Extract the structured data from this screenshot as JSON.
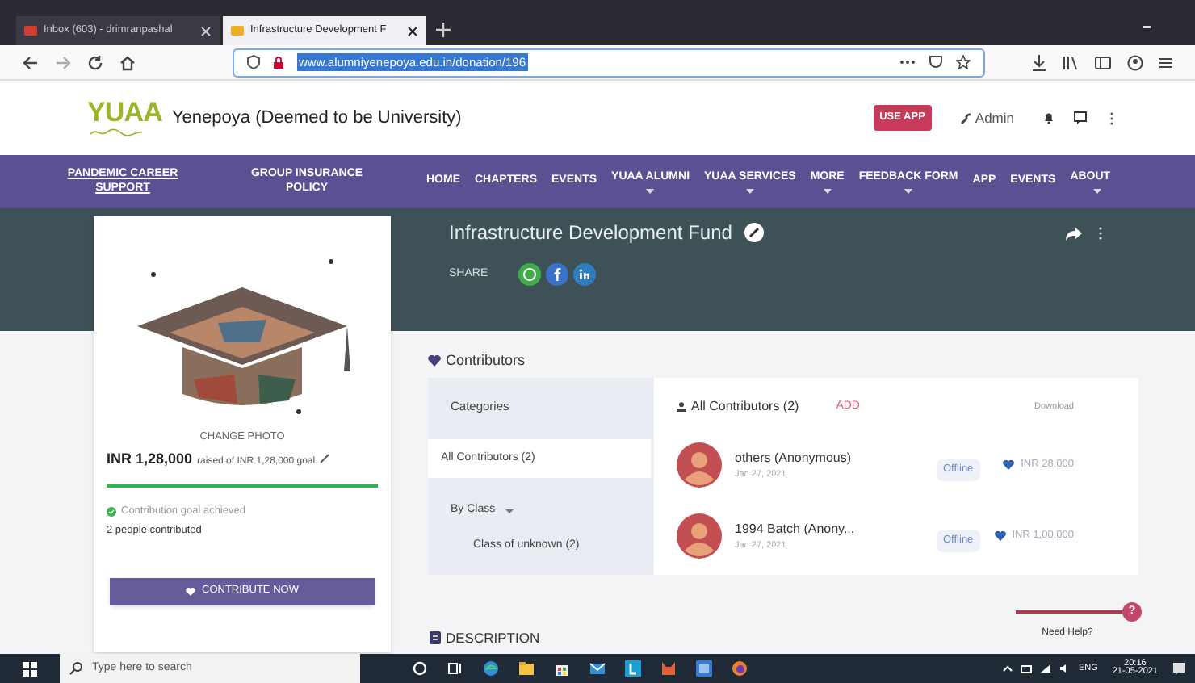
{
  "browser": {
    "tabs": [
      {
        "title": "Inbox (603) - drimranpashal",
        "selected": false
      },
      {
        "title": "Infrastructure Development F",
        "selected": true
      }
    ],
    "url": "www.alumniyenepoya.edu.in/donation/196"
  },
  "site": {
    "logo_text": "YUAA",
    "name": "Yenepoya (Deemed to be University)",
    "use_app": "USE APP",
    "admin": "Admin"
  },
  "nav": [
    {
      "label": "PANDEMIC CAREER SUPPORT",
      "selected": true,
      "has_dropdown": false
    },
    {
      "label": "GROUP INSURANCE POLICY",
      "selected": false,
      "has_dropdown": false
    },
    {
      "label": "HOME",
      "selected": false,
      "has_dropdown": false
    },
    {
      "label": "CHAPTERS",
      "selected": false,
      "has_dropdown": false
    },
    {
      "label": "EVENTS",
      "selected": false,
      "has_dropdown": false
    },
    {
      "label": "YUAA ALUMNI",
      "selected": false,
      "has_dropdown": true
    },
    {
      "label": "YUAA SERVICES",
      "selected": false,
      "has_dropdown": true
    },
    {
      "label": "MORE",
      "selected": false,
      "has_dropdown": true
    },
    {
      "label": "FEEDBACK FORM",
      "selected": false,
      "has_dropdown": true
    },
    {
      "label": "APP",
      "selected": false,
      "has_dropdown": false
    },
    {
      "label": "EVENTS",
      "selected": false,
      "has_dropdown": false
    },
    {
      "label": "ABOUT",
      "selected": false,
      "has_dropdown": true
    }
  ],
  "fund": {
    "title": "Infrastructure Development Fund",
    "share_label": "SHARE"
  },
  "card": {
    "change_photo": "CHANGE PHOTO",
    "raised": "INR 1,28,000",
    "raised_note": "raised of INR 1,28,000 goal",
    "level": 1.0,
    "achieved": "Contribution goal achieved",
    "people": "2 people contributed",
    "button": "CONTRIBUTE NOW"
  },
  "contributors": {
    "heading": "Contributors",
    "categories_title": "Categories",
    "categories": [
      {
        "label": "All Contributors (2)",
        "selected": true
      },
      {
        "label": "By Class",
        "selected": false,
        "expanded": true,
        "children": [
          {
            "label": "Class of unknown (2)",
            "selected": false
          }
        ]
      }
    ],
    "list_title": "All Contributors (2)",
    "add": "ADD",
    "download": "Download",
    "rows": [
      {
        "name": "others (Anonymous)",
        "date": "Jan 27, 2021",
        "mode": "Offline",
        "amount": "INR 28,000"
      },
      {
        "name": "1994 Batch (Anony...",
        "date": "Jan 27, 2021",
        "mode": "Offline",
        "amount": "INR 1,00,000"
      }
    ]
  },
  "description": "DESCRIPTION",
  "help": {
    "label": "Need Help?",
    "icon": "?"
  },
  "taskbar": {
    "search_placeholder": "Type here to search",
    "language": "ENG",
    "time": "20:16",
    "date": "21-05-2021"
  }
}
